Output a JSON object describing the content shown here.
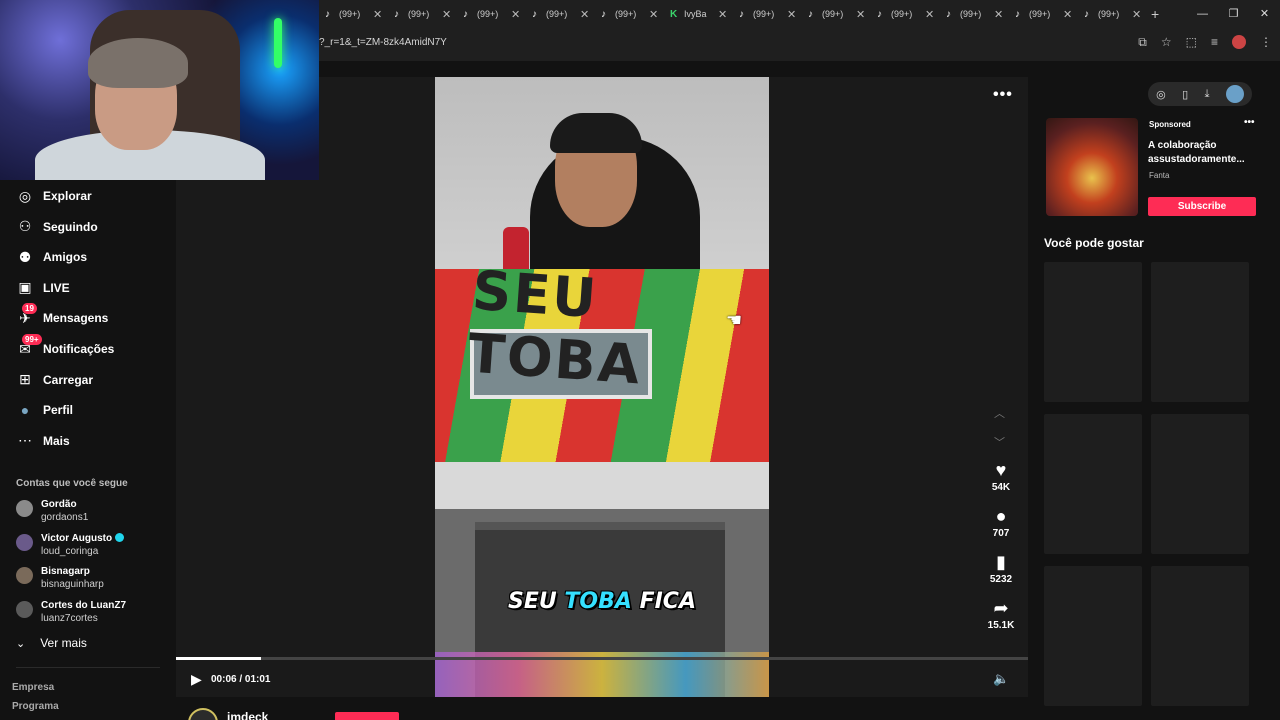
{
  "browser": {
    "tabs": [
      {
        "title": "(99+)",
        "icon": "tiktok-icon"
      },
      {
        "title": "(99+)",
        "icon": "tiktok-icon"
      },
      {
        "title": "(99+)",
        "icon": "tiktok-icon"
      },
      {
        "title": "(99+)",
        "icon": "tiktok-icon"
      },
      {
        "title": "(99+)",
        "icon": "tiktok-icon"
      },
      {
        "title": "IvyBa",
        "icon": "kick-icon"
      },
      {
        "title": "(99+)",
        "icon": "tiktok-icon"
      },
      {
        "title": "(99+)",
        "icon": "tiktok-icon"
      },
      {
        "title": "(99+)",
        "icon": "tiktok-icon"
      },
      {
        "title": "(99+)",
        "icon": "tiktok-icon"
      },
      {
        "title": "(99+)",
        "icon": "tiktok-icon"
      },
      {
        "title": "(99+)",
        "icon": "tiktok-icon"
      }
    ],
    "url": "?_r=1&_t=ZM-8zk4AmidN7Y"
  },
  "sidebar": {
    "nav": [
      {
        "label": "Explorar",
        "icon": "compass-icon"
      },
      {
        "label": "Seguindo",
        "icon": "user-follow-icon"
      },
      {
        "label": "Amigos",
        "icon": "friends-icon"
      },
      {
        "label": "LIVE",
        "icon": "live-icon"
      },
      {
        "label": "Mensagens",
        "icon": "message-icon",
        "badge": "19"
      },
      {
        "label": "Notificações",
        "icon": "notification-icon",
        "badge": "99+"
      },
      {
        "label": "Carregar",
        "icon": "upload-icon"
      },
      {
        "label": "Perfil",
        "icon": "profile-avatar"
      },
      {
        "label": "Mais",
        "icon": "more-icon"
      }
    ],
    "following_header": "Contas que você segue",
    "following": [
      {
        "name": "Gordão",
        "handle": "gordaons1",
        "verified": false
      },
      {
        "name": "Victor Augusto",
        "handle": "loud_coringa",
        "verified": true
      },
      {
        "name": "Bisnagarp",
        "handle": "bisnaguinharp",
        "verified": false
      },
      {
        "name": "Cortes do LuanZ7",
        "handle": "luanz7cortes",
        "verified": false
      }
    ],
    "see_more": "Ver mais",
    "footer": [
      "Empresa",
      "Programa"
    ]
  },
  "video": {
    "sign_text": "SEU TOBA",
    "caption_pre": "SEU ",
    "caption_hl": "TOBA",
    "caption_post": " FICA",
    "progress": 0.1,
    "time": "00:06 / 01:01",
    "actions": [
      {
        "icon": "heart-icon",
        "count": "54K"
      },
      {
        "icon": "comment-icon",
        "count": "707"
      },
      {
        "icon": "bookmark-icon",
        "count": "5232"
      },
      {
        "icon": "share-icon",
        "count": "15.1K"
      }
    ],
    "author": "imdeck"
  },
  "ad": {
    "sponsored": "Sponsored",
    "title": "A colaboração assustadoramente...",
    "brand": "Fanta",
    "button": "Subscribe"
  },
  "suggestions": {
    "header": "Você pode gostar",
    "count": 6
  },
  "colors": {
    "accent": "#fe2c55",
    "background": "#121212"
  }
}
